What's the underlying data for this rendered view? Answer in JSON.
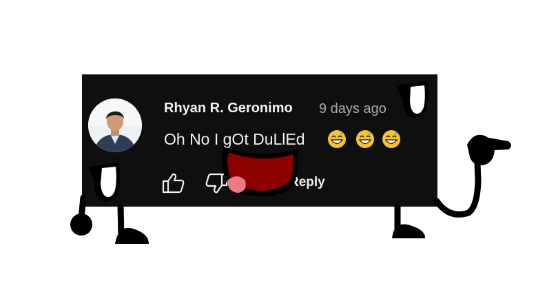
{
  "comment": {
    "author": "Rhyan R. Geronimo",
    "timestamp": "9 days ago",
    "text": "Oh No I gOt DuLlEd",
    "emojis": [
      "grinning-sweat-emoji",
      "grinning-sweat-emoji",
      "grinning-sweat-emoji"
    ]
  },
  "actions": {
    "like_icon": "thumbs-up-icon",
    "dislike_icon": "thumbs-down-icon",
    "reply_label": "Reply"
  },
  "colors": {
    "card_background": "#0f0f0f",
    "text_primary": "#f1f1f1",
    "text_secondary": "#aaaaaa",
    "mouth_red": "#8b0000"
  }
}
